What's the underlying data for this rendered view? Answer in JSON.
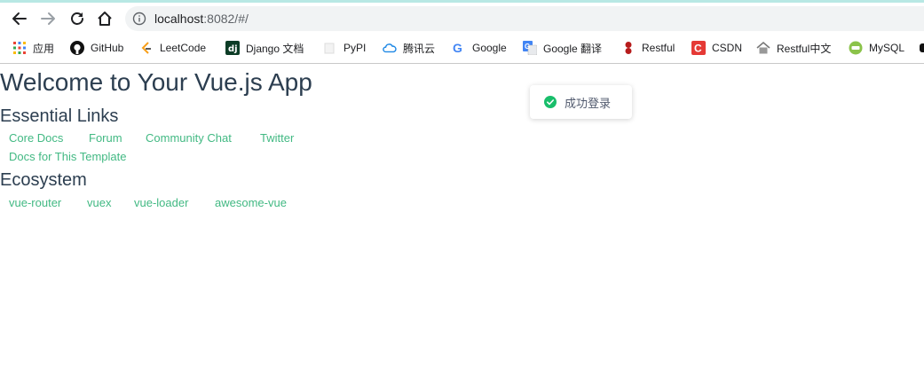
{
  "browser": {
    "url_host": "localhost",
    "url_rest": ":8082/#/"
  },
  "bookmarks": [
    {
      "label": "应用",
      "icon": "apps-grid-icon"
    },
    {
      "label": "GitHub",
      "icon": "github-icon"
    },
    {
      "label": "LeetCode",
      "icon": "leetcode-icon"
    },
    {
      "label": "Django 文档",
      "icon": "django-icon"
    },
    {
      "label": "PyPI",
      "icon": "pypi-icon"
    },
    {
      "label": "腾讯云",
      "icon": "cloud-icon"
    },
    {
      "label": "Google",
      "icon": "google-icon"
    },
    {
      "label": "Google 翻译",
      "icon": "translate-icon"
    },
    {
      "label": "Restful",
      "icon": "restful-icon"
    },
    {
      "label": "CSDN",
      "icon": "csdn-icon"
    },
    {
      "label": "Restful中文",
      "icon": "house-icon"
    },
    {
      "label": "MySQL",
      "icon": "mysql-icon"
    }
  ],
  "page": {
    "title": "Welcome to Your Vue.js App",
    "essential_heading": "Essential Links",
    "essential_links": [
      "Core Docs",
      "Forum",
      "Community Chat",
      "Twitter",
      "Docs for This Template"
    ],
    "ecosystem_heading": "Ecosystem",
    "ecosystem_links": [
      "vue-router",
      "vuex",
      "vue-loader",
      "awesome-vue"
    ]
  },
  "toast": {
    "message": "成功登录",
    "icon": "check-circle-icon"
  },
  "colors": {
    "link": "#42b983",
    "text": "#2c3e50",
    "success": "#19be6b"
  }
}
